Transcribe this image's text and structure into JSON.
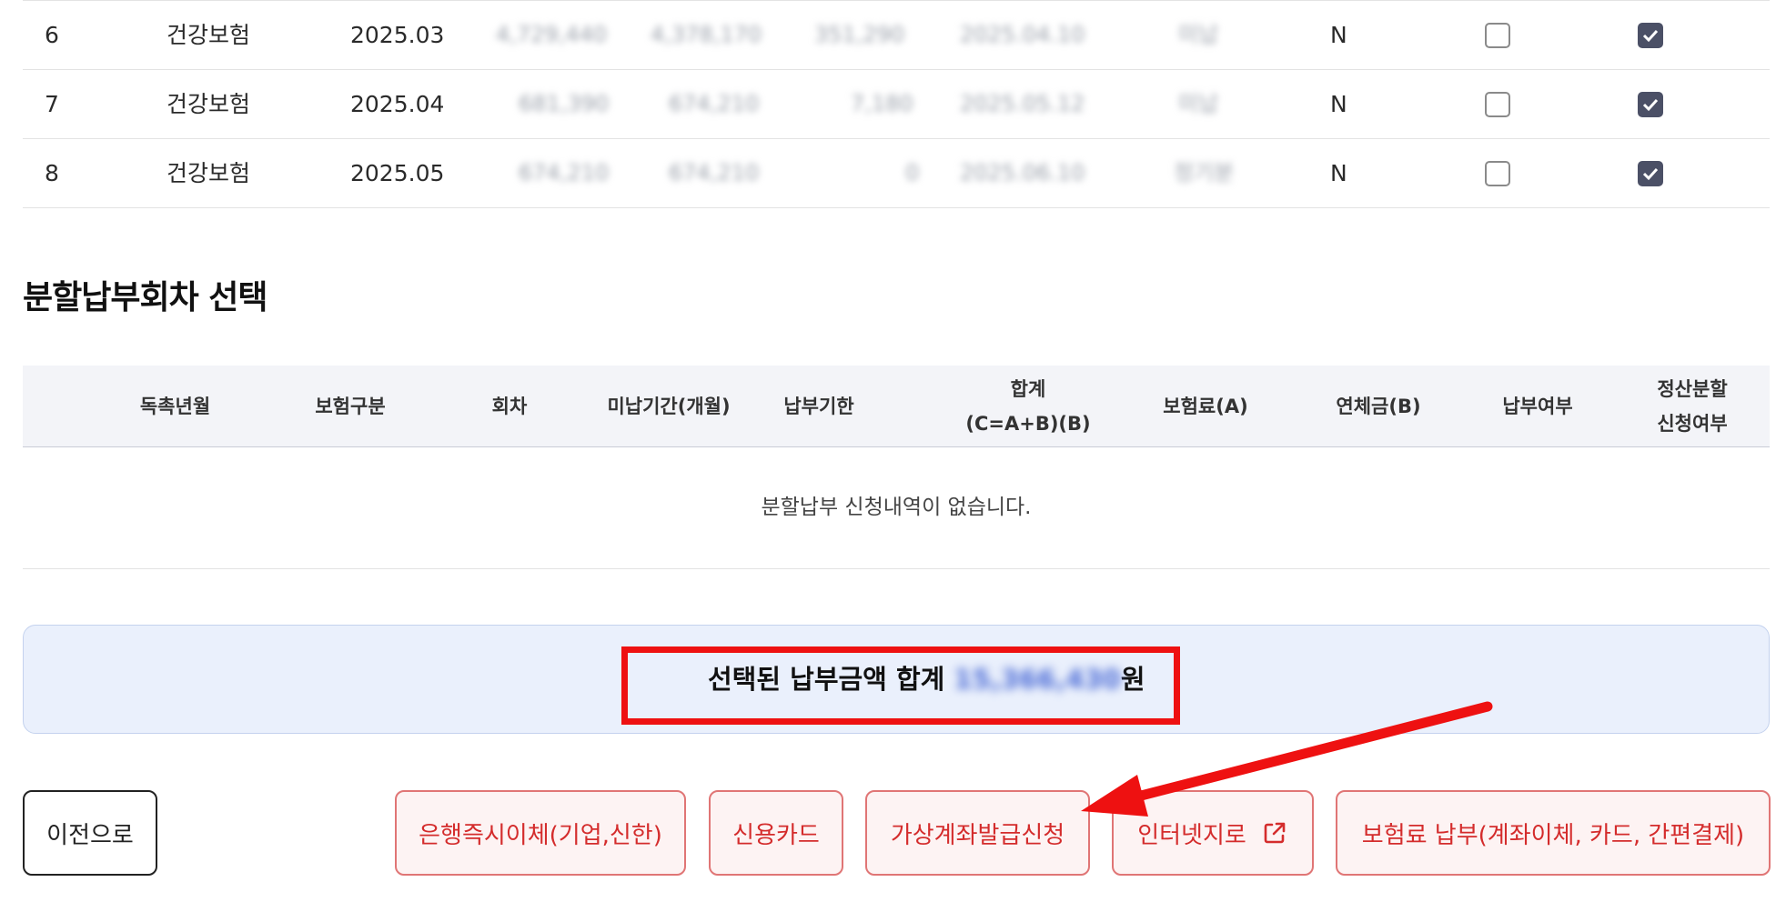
{
  "top_rows": [
    {
      "no": "6",
      "type": "건강보험",
      "ym": "2025.03",
      "blur": [
        "4,729,440",
        "4,378,170",
        "351,290",
        "2025.04.10",
        "미납"
      ],
      "flag": "N",
      "chk1": false,
      "chk2": true
    },
    {
      "no": "7",
      "type": "건강보험",
      "ym": "2025.04",
      "blur": [
        "681,390",
        "674,210",
        "7,180",
        "2025.05.12",
        "미납"
      ],
      "flag": "N",
      "chk1": false,
      "chk2": true
    },
    {
      "no": "8",
      "type": "건강보험",
      "ym": "2025.05",
      "blur": [
        "674,210",
        "674,210",
        "0",
        "2025.06.10",
        "정기분"
      ],
      "flag": "N",
      "chk1": false,
      "chk2": true
    }
  ],
  "installment": {
    "title": "분할납부회차 선택",
    "headers": [
      "독촉년월",
      "보험구분",
      "회차",
      "미납기간(개월)",
      "납부기한",
      "합계\n(C=A+B)(B)",
      "보험료(A)",
      "연체금(B)",
      "납부여부",
      "정산분할\n신청여부"
    ],
    "empty_message": "분할납부 신청내역이 없습니다."
  },
  "total": {
    "prefix": "선택된 납부금액 합계 ",
    "amount": "15,366,430",
    "suffix": "원"
  },
  "buttons": {
    "prev": "이전으로",
    "bank_transfer": "은행즉시이체(기업,신한)",
    "credit_card": "신용카드",
    "virtual_account": "가상계좌발급신청",
    "internet_giro": "인터넷지로",
    "premium_pay": "보험료 납부(계좌이체, 카드, 간편결제)"
  },
  "colors": {
    "accent_red": "#d42c2c",
    "highlight": "#ee1111",
    "total_bg": "#eaf0fc",
    "checkbox_on": "#4b5066"
  }
}
